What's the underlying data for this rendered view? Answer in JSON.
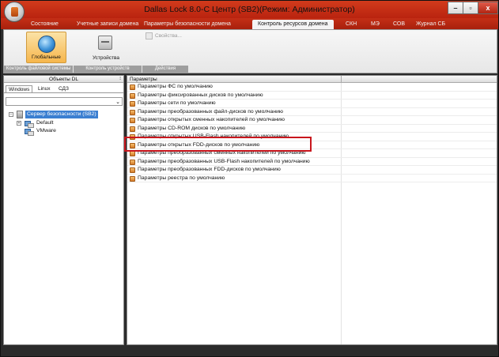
{
  "window": {
    "title": "Dallas Lock 8.0-С Центр (SB2)(Режим: Администратор)",
    "controls": {
      "minimize": "–",
      "maximize": "▫",
      "close": "x"
    }
  },
  "menu_tabs": [
    "Состояние",
    "Учетные записи домена",
    "Параметры безопасности домена",
    "Контроль ресурсов домена",
    "СКН",
    "МЭ",
    "СОВ",
    "Журнал СБ"
  ],
  "active_tab": "Контроль ресурсов домена",
  "ribbon": {
    "groups": [
      {
        "label": "Контроль файловой системы",
        "button": "Глобальные"
      },
      {
        "label": "Контроль устройств",
        "button": "Устройства"
      },
      {
        "label": "Действия",
        "button": "Свойства..."
      }
    ]
  },
  "left_panel": {
    "title": "Объекты DL",
    "pin_icon": "pin-icon",
    "tabs": [
      "Windows",
      "Linux",
      "СДЗ"
    ],
    "combo_value": "",
    "tree": {
      "root": "Сервер безопасности (SB2)",
      "children": [
        "Default",
        "VMware"
      ]
    }
  },
  "right_panel": {
    "column_header": "Параметры",
    "rows": [
      "Параметры ФС по умолчанию",
      "Параметры фиксированных дисков по умолчанию",
      "Параметры сети по умолчанию",
      "Параметры преобразованных файл-дисков по умолчанию",
      "Параметры открытых сменных накопителей по умолчанию",
      "Параметры CD-ROM дисков по умолчанию",
      "Параметры открытых USB-Flash накопителей по умолчанию",
      "Параметры открытых FDD-дисков по умолчанию",
      "Параметры преобразованных сменных накопителей по умолчанию",
      "Параметры преобразованных USB-Flash накопителей по умолчанию",
      "Параметры преобразованных FDD-дисков по умолчанию",
      "Параметры реестра по умолчанию"
    ],
    "highlighted_row": "Параметры открытых USB-Flash накопителей по умолчанию",
    "highlight_color": "#c8161d"
  }
}
